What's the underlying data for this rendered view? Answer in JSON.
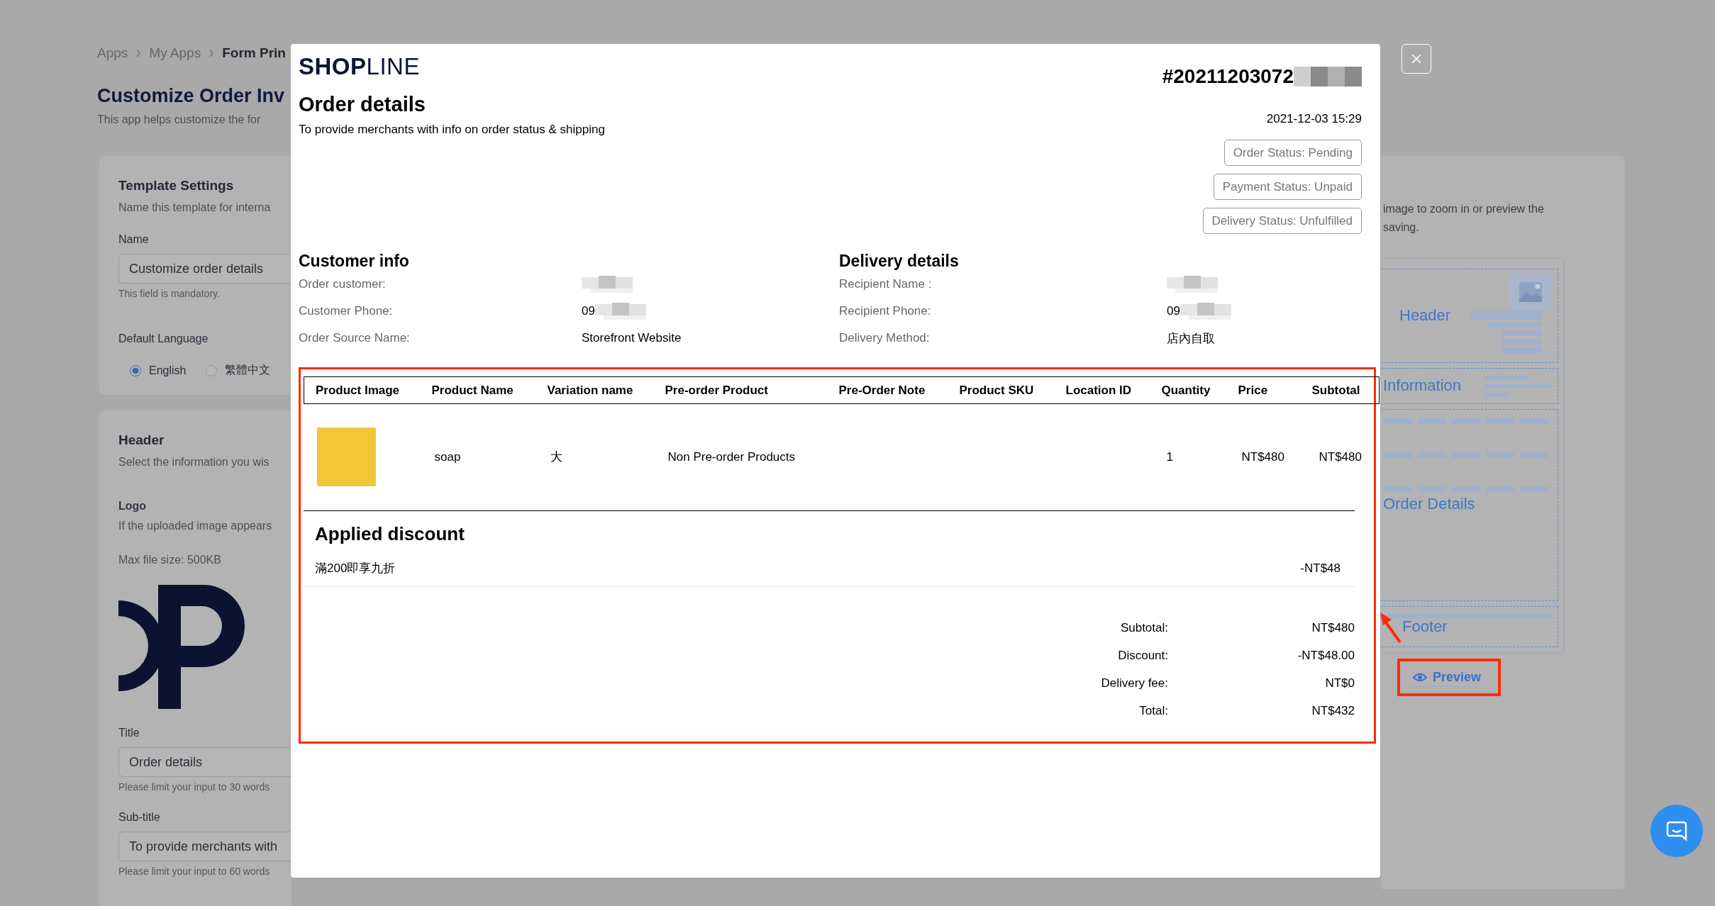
{
  "breadcrumb": [
    "Apps",
    "My Apps",
    "Form Prin"
  ],
  "page_title": "Customize Order Inv",
  "page_subtitle": "This app helps customize the for",
  "template_settings": {
    "title": "Template Settings",
    "description": "Name this template for interna",
    "name_field": {
      "label": "Name",
      "value": "Customize order details",
      "hint": "This field is mandatory."
    },
    "language": {
      "label": "Default Language",
      "options": [
        {
          "label": "English",
          "selected": true
        },
        {
          "label": "繁體中文",
          "selected": false
        }
      ]
    }
  },
  "header_settings": {
    "title": "Header",
    "description": "Select the information you wis",
    "logo": {
      "label": "Logo",
      "description": "If the uploaded image appears",
      "max_size": "Max file size: 500KB"
    },
    "title_field": {
      "label": "Title",
      "value": "Order details",
      "hint": "Please limit your input to 30 words"
    },
    "subtitle_field": {
      "label": "Sub-title",
      "value": "To provide merchants with",
      "hint": "Please limit your input to 60 words"
    }
  },
  "preview_card": {
    "description": "image to zoom in or preview the\nsaving.",
    "sections": [
      "Header",
      "Information",
      "Order Details",
      "Footer"
    ],
    "preview_button": "Preview"
  },
  "modal": {
    "logo": "**SHOP**LINE",
    "title": "Order details",
    "subtitle": "To provide merchants with info on order status & shipping",
    "order_number": {
      "text": "#20211203072",
      "redacted": true
    },
    "date": "2021-12-03 15:29",
    "statuses": [
      "Order Status: Pending",
      "Payment Status: Unpaid",
      "Delivery Status: Unfulfilled"
    ],
    "customer_info": {
      "title": "Customer info",
      "rows": [
        {
          "label": "Order customer:",
          "redacted": true
        },
        {
          "label": "Customer Phone:",
          "value": "09",
          "redacted": true
        },
        {
          "label": "Order Source Name:",
          "value": "Storefront Website",
          "redacted": false
        }
      ]
    },
    "delivery_details": {
      "title": "Delivery details",
      "rows": [
        {
          "label": "Recipient Name :",
          "redacted": true
        },
        {
          "label": "Recipient Phone:",
          "value": "09",
          "redacted": true
        },
        {
          "label": "Delivery Method:",
          "value": "店內自取",
          "redacted": false
        }
      ]
    },
    "table": {
      "columns": [
        "Product Image",
        "Product Name",
        "Variation name",
        "Pre-order Product",
        "Pre-Order Note",
        "Product SKU",
        "Location ID",
        "Quantity",
        "Price",
        "Subtotal"
      ],
      "rows": [
        {
          "product_name": "soap",
          "variation": "大",
          "pre_order": "Non Pre-order Products",
          "quantity": "1",
          "price": "NT$480",
          "subtotal": "NT$480"
        }
      ]
    },
    "discount": {
      "title": "Applied discount",
      "items": [
        {
          "name": "滿200即享九折",
          "amount": "-NT$48"
        }
      ]
    },
    "totals": [
      {
        "label": "Subtotal:",
        "value": "NT$480"
      },
      {
        "label": "Discount:",
        "value": "-NT$48.00"
      },
      {
        "label": "Delivery fee:",
        "value": "NT$0"
      },
      {
        "label": "Total:",
        "value": "NT$432"
      }
    ]
  }
}
